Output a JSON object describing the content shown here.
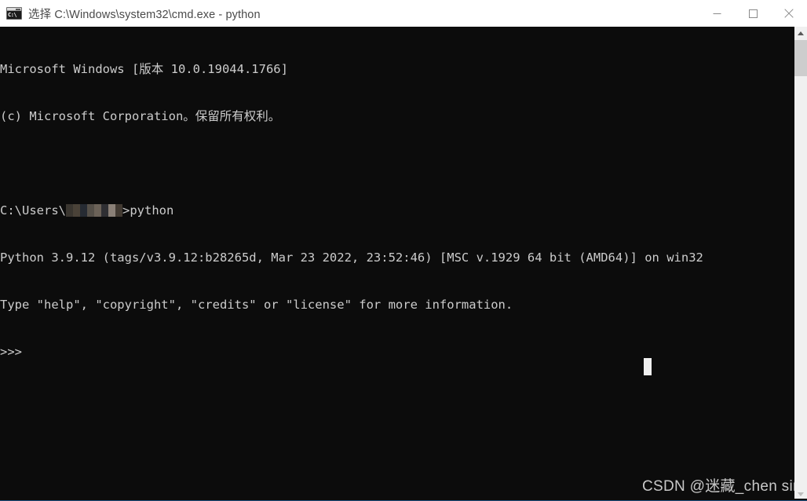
{
  "window": {
    "title": "选择 C:\\Windows\\system32\\cmd.exe - python",
    "icon": "cmd-exe-icon",
    "icon_text": "C:\\",
    "background_color": "#0c0c0c",
    "titlebar_color": "#ffffff"
  },
  "window_controls": {
    "minimize_label": "最小化",
    "maximize_label": "最大化",
    "close_label": "关闭"
  },
  "console": {
    "text_color": "#cccccc",
    "font_size_px": 15.5,
    "lines": [
      "Microsoft Windows [版本 10.0.19044.1766]",
      "(c) Microsoft Corporation。保留所有权利。",
      "",
      "C:\\Users\\",
      "Python 3.9.12 (tags/v3.9.12:b28265d, Mar 23 2022, 23:52:46) [MSC v.1929 64 bit (AMD64)] on win32",
      "Type \"help\", \"copyright\", \"credits\" or \"license\" for more information.",
      ">>>"
    ],
    "prompt_line": {
      "prefix": "C:\\Users\\",
      "redacted_username": "",
      "suffix": ">python"
    },
    "banner_line_1": "Microsoft Windows [版本 10.0.19044.1766]",
    "banner_line_2": "(c) Microsoft Corporation。保留所有权利。",
    "python_version_line": "Python 3.9.12 (tags/v3.9.12:b28265d, Mar 23 2022, 23:52:46) [MSC v.1929 64 bit (AMD64)] on win32",
    "python_help_line": "Type \"help\", \"copyright\", \"credits\" or \"license\" for more information.",
    "python_prompt": ">>>",
    "cursor": "block-cursor"
  },
  "scrollbar": {
    "up_arrow": "chevron-up-icon",
    "down_arrow": "chevron-down-icon",
    "thumb": "scrollbar-thumb"
  },
  "watermark": {
    "text": "CSDN @迷藏_chen sir"
  }
}
